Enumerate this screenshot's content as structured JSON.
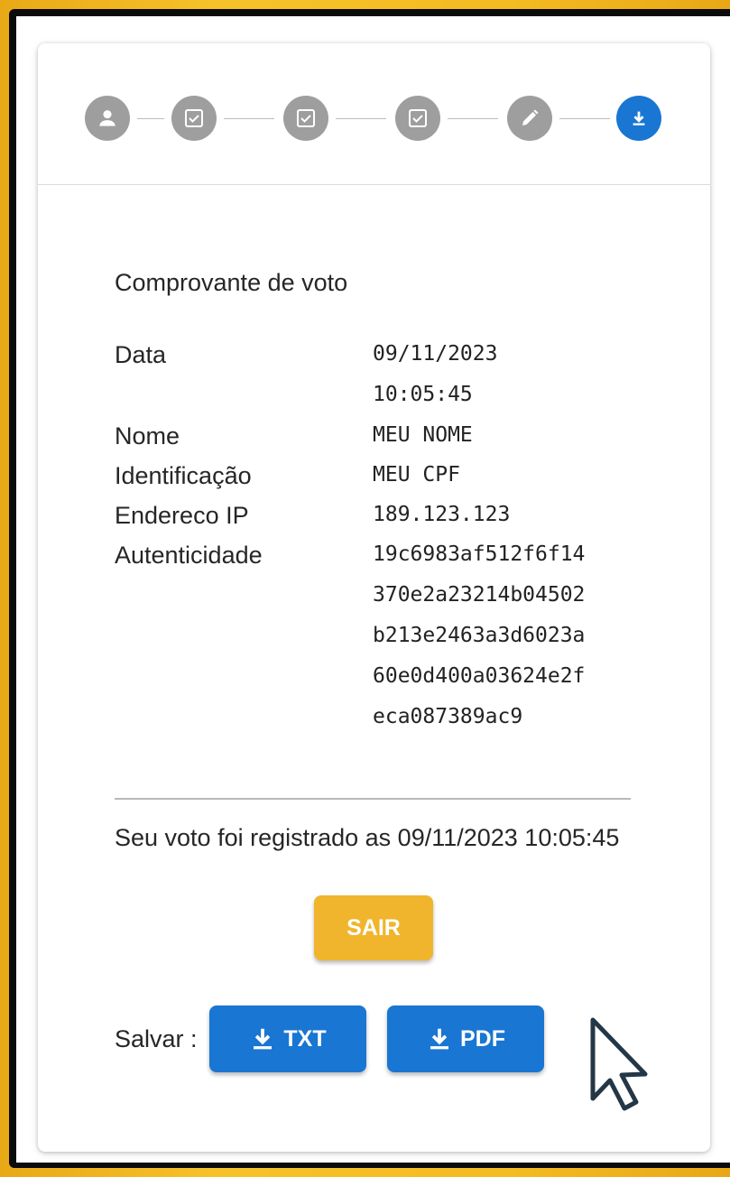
{
  "stepper": {
    "steps": [
      {
        "icon": "person-icon",
        "state": "done"
      },
      {
        "icon": "check-box-icon",
        "state": "done"
      },
      {
        "icon": "check-box-icon",
        "state": "done"
      },
      {
        "icon": "check-box-icon",
        "state": "done"
      },
      {
        "icon": "pencil-icon",
        "state": "done"
      },
      {
        "icon": "download-icon",
        "state": "active"
      }
    ],
    "active_color": "#1976d2",
    "inactive_color": "#9e9e9e"
  },
  "receipt": {
    "title": "Comprovante de voto",
    "rows": [
      {
        "label": "Data",
        "value_lines": [
          "09/11/2023",
          "10:05:45"
        ]
      },
      {
        "label": "Nome",
        "value_lines": [
          "MEU NOME"
        ]
      },
      {
        "label": "Identificação",
        "value_lines": [
          "MEU CPF"
        ]
      },
      {
        "label": "Endereco IP",
        "value_lines": [
          "189.123.123"
        ]
      },
      {
        "label": "Autenticidade",
        "value_lines": [
          "19c6983af512f6f14",
          "370e2a23214b04502",
          "b213e2463a3d6023a",
          "60e0d400a03624e2f",
          "eca087389ac9"
        ]
      }
    ],
    "registered_message": "Seu voto foi registrado as 09/11/2023 10:05:45"
  },
  "actions": {
    "exit_label": "SAIR",
    "save_label": "Salvar :",
    "txt_label": "TXT",
    "pdf_label": "PDF",
    "exit_color": "#f0b52c",
    "download_color": "#1976d2"
  }
}
